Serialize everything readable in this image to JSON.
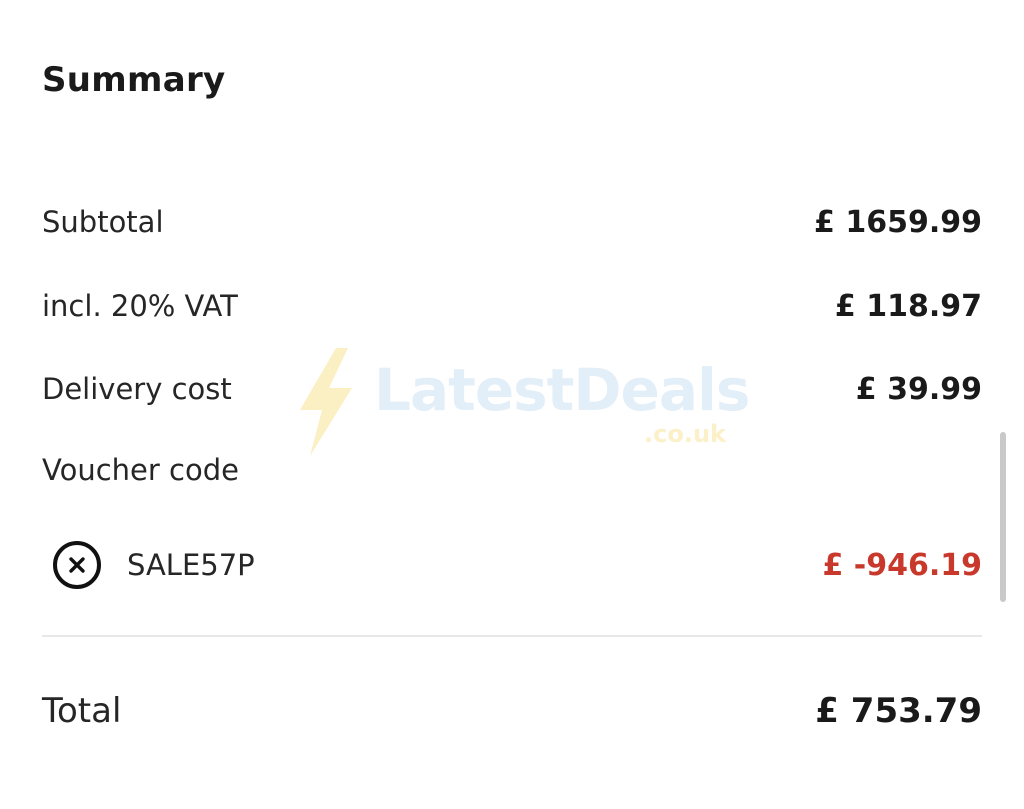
{
  "summary": {
    "title": "Summary",
    "subtotal": {
      "label": "Subtotal",
      "value": "£ 1659.99"
    },
    "vat": {
      "label": "incl. 20% VAT",
      "value": "£ 118.97"
    },
    "delivery": {
      "label": "Delivery cost",
      "value": "£ 39.99"
    },
    "voucher": {
      "heading": "Voucher code",
      "code": "SALE57P",
      "discount": "£ -946.19",
      "remove_icon": "close-circle-icon"
    },
    "total": {
      "label": "Total",
      "value": "£ 753.79"
    }
  },
  "watermark": {
    "text": "LatestDeals",
    "suffix": ".co.uk",
    "icon": "lightning-bolt-icon"
  },
  "colors": {
    "text": "#1a1a1a",
    "discount": "#c8392b",
    "divider": "#e8e8e8",
    "watermark_text": "#e2eef8",
    "watermark_bolt": "#fbefc4",
    "scrollbar": "#c9c9c9"
  }
}
